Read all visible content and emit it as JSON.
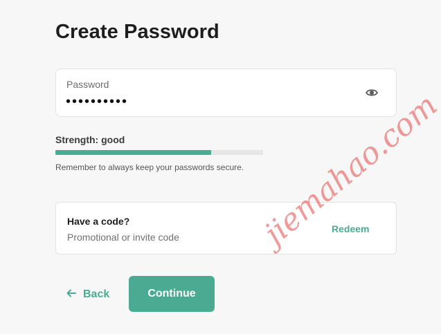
{
  "page": {
    "title": "Create Password"
  },
  "password": {
    "label": "Password",
    "value": "••••••••••",
    "toggle_icon": "eye-icon"
  },
  "strength": {
    "label": "Strength: good",
    "level": 0.75,
    "color": "#4aab92",
    "hint": "Remember to always keep your passwords secure."
  },
  "promo": {
    "title": "Have a code?",
    "placeholder": "Promotional or invite code",
    "redeem_label": "Redeem"
  },
  "nav": {
    "back_label": "Back",
    "back_icon": "arrow-left-icon",
    "continue_label": "Continue"
  },
  "watermark": {
    "text": "jiemahao.com"
  },
  "theme": {
    "accent": "#4aab92",
    "background": "#f7f7f7"
  }
}
